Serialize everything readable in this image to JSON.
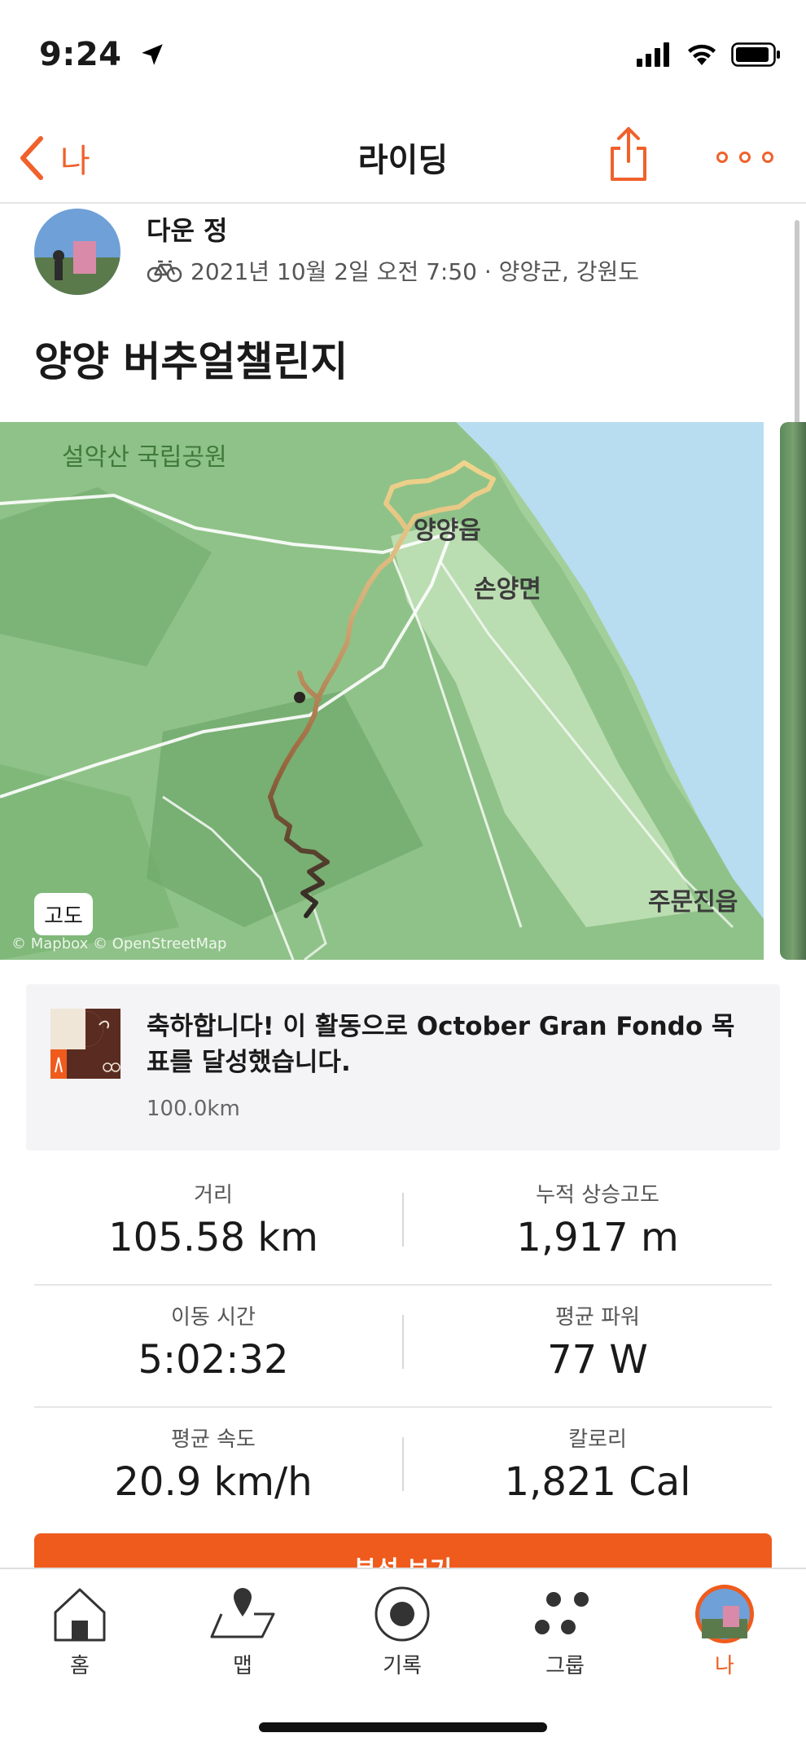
{
  "status": {
    "time": "9:24"
  },
  "nav": {
    "back_label": "나",
    "title": "라이딩"
  },
  "athlete": {
    "name": "다운 정",
    "meta": "2021년 10월 2일 오전 7:50 · 양양군, 강원도"
  },
  "activity": {
    "title": "양양 버추얼챌린지"
  },
  "map": {
    "labels": {
      "park": "설악산 국립공원",
      "town": "양양읍",
      "district": "손양면",
      "jumunjin": "주문진읍"
    },
    "elevation_button": "고도",
    "attribution": "© Mapbox © OpenStreetMap"
  },
  "goal": {
    "title": "축하합니다! 이 활동으로 October Gran Fondo 목표를 달성했습니다.",
    "subtitle": "100.0km"
  },
  "stats": [
    {
      "left": {
        "label": "거리",
        "value": "105.58 km"
      },
      "right": {
        "label": "누적 상승고도",
        "value": "1,917 m"
      }
    },
    {
      "left": {
        "label": "이동 시간",
        "value": "5:02:32"
      },
      "right": {
        "label": "평균 파워",
        "value": "77 W"
      }
    },
    {
      "left": {
        "label": "평균 속도",
        "value": "20.9 km/h"
      },
      "right": {
        "label": "칼로리",
        "value": "1,821 Cal"
      }
    }
  ],
  "analysis_button": "분석 보기",
  "tabs": [
    {
      "label": "홈",
      "icon": "home-icon"
    },
    {
      "label": "맵",
      "icon": "map-icon"
    },
    {
      "label": "기록",
      "icon": "record-icon"
    },
    {
      "label": "그룹",
      "icon": "groups-icon"
    },
    {
      "label": "나",
      "icon": "avatar"
    }
  ],
  "colors": {
    "accent": "#ef5b1d",
    "map_land": "#a8d4a0",
    "map_water": "#b6dcef"
  }
}
